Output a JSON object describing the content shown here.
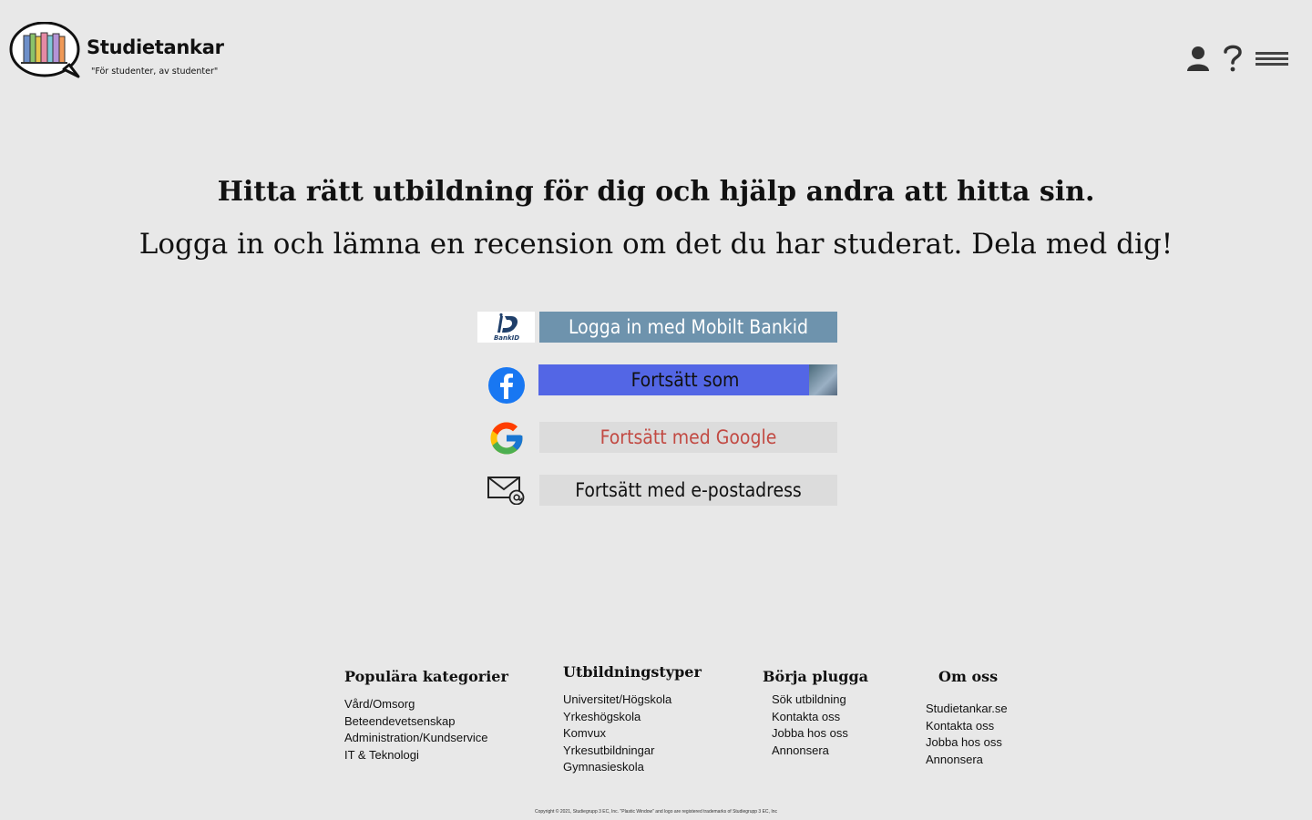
{
  "brand": {
    "name": "Studietankar",
    "tagline": "\"För studenter, av studenter\""
  },
  "header": {
    "icons": [
      "user-icon",
      "help-icon",
      "menu-icon"
    ]
  },
  "hero": {
    "title": "Hitta rätt utbildning för dig och hjälp andra att hitta sin.",
    "subtitle": "Logga in och lämna en recension om det du har studerat. Dela med dig!"
  },
  "login": {
    "bankid_label": "Logga in med Mobilt Bankid",
    "bankid_logo_text": "BankID",
    "facebook_label": "Fortsätt som",
    "google_label": "Fortsätt med Google",
    "email_label": "Fortsätt med e-postadress"
  },
  "colors": {
    "background": "#e8e8e8",
    "bankid_button": "#6e93ad",
    "facebook_button": "#5366e5",
    "google_text": "#c24a43",
    "neutral_button": "#dcdcdc"
  },
  "footer": {
    "columns": [
      {
        "title": "Populära kategorier",
        "items": [
          "Vård/Omsorg",
          "Beteendevetsenskap",
          "Administration/Kundservice",
          "IT & Teknologi"
        ]
      },
      {
        "title": "Utbildningstyper",
        "items": [
          "Universitet/Högskola",
          "Yrkeshögskola",
          "Komvux",
          "Yrkesutbildningar",
          "Gymnasieskola"
        ]
      },
      {
        "title": "Börja plugga",
        "items": [
          "Sök utbildning",
          "Kontakta oss",
          "Jobba hos oss",
          "Annonsera"
        ]
      },
      {
        "title": "Om oss",
        "items": [
          "Studietankar.se",
          "Kontakta oss",
          "Jobba hos oss",
          "Annonsera"
        ]
      }
    ],
    "copyright": "Copyright © 2021, Studiegrupp 3 EC, Inc. \"Plastic Window\" and logo are registered trademarks of Studiegrupp 3 EC, Inc"
  }
}
